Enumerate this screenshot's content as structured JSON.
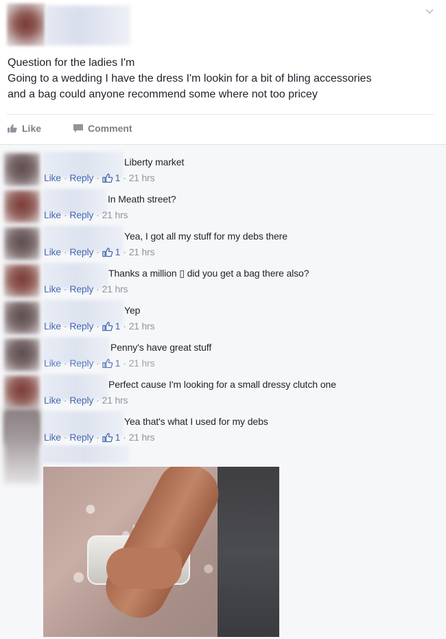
{
  "post": {
    "author_name": "",
    "text_lines": [
      "Question for the ladies I'm",
      "Going to a wedding I have the dress I'm lookin for a bit of bling accessories",
      "and a bag could anyone recommend some where not too pricey"
    ],
    "actions": {
      "like": "Like",
      "comment": "Comment"
    }
  },
  "meta_labels": {
    "like": "Like",
    "reply": "Reply",
    "sep": "·"
  },
  "comments": [
    {
      "text": "Liberty market",
      "likes": "1",
      "time": "21 hrs"
    },
    {
      "text": "In Meath street?",
      "likes": "",
      "time": "21 hrs"
    },
    {
      "text": "Yea, I got all my stuff for my debs there",
      "likes": "1",
      "time": "21 hrs"
    },
    {
      "text": "Thanks a million ▯ did you get a bag there also?",
      "likes": "",
      "time": "21 hrs"
    },
    {
      "text": "Yep",
      "likes": "1",
      "time": "21 hrs"
    },
    {
      "text": "Penny's have great stuff",
      "likes": "1",
      "time": "21 hrs"
    },
    {
      "text": "Perfect cause I'm looking for a small dressy clutch one",
      "likes": "",
      "time": "21 hrs"
    },
    {
      "text": "Yea that's what I used for my debs",
      "likes": "1",
      "time": "21 hrs"
    }
  ],
  "colors": {
    "link": "#4267b2",
    "meta": "#90949c",
    "comments_bg": "#f6f7f9"
  },
  "icons": {
    "chevron": "chevron-down-icon",
    "like": "thumbs-up-icon",
    "comment": "comment-icon"
  }
}
